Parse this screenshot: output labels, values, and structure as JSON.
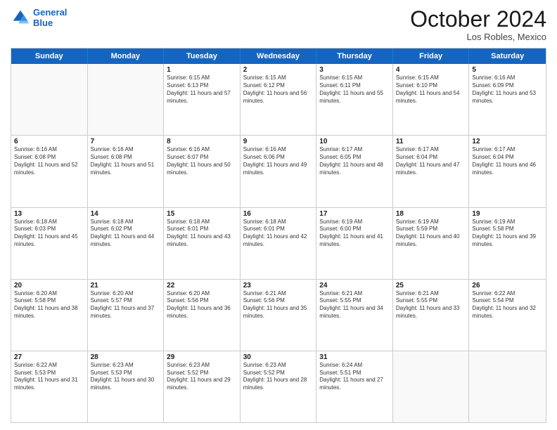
{
  "header": {
    "logo_line1": "General",
    "logo_line2": "Blue",
    "month": "October 2024",
    "location": "Los Robles, Mexico"
  },
  "days_of_week": [
    "Sunday",
    "Monday",
    "Tuesday",
    "Wednesday",
    "Thursday",
    "Friday",
    "Saturday"
  ],
  "weeks": [
    [
      {
        "day": "",
        "sunrise": "",
        "sunset": "",
        "daylight": ""
      },
      {
        "day": "",
        "sunrise": "",
        "sunset": "",
        "daylight": ""
      },
      {
        "day": "1",
        "sunrise": "Sunrise: 6:15 AM",
        "sunset": "Sunset: 6:13 PM",
        "daylight": "Daylight: 11 hours and 57 minutes."
      },
      {
        "day": "2",
        "sunrise": "Sunrise: 6:15 AM",
        "sunset": "Sunset: 6:12 PM",
        "daylight": "Daylight: 11 hours and 56 minutes."
      },
      {
        "day": "3",
        "sunrise": "Sunrise: 6:15 AM",
        "sunset": "Sunset: 6:11 PM",
        "daylight": "Daylight: 11 hours and 55 minutes."
      },
      {
        "day": "4",
        "sunrise": "Sunrise: 6:15 AM",
        "sunset": "Sunset: 6:10 PM",
        "daylight": "Daylight: 11 hours and 54 minutes."
      },
      {
        "day": "5",
        "sunrise": "Sunrise: 6:16 AM",
        "sunset": "Sunset: 6:09 PM",
        "daylight": "Daylight: 11 hours and 53 minutes."
      }
    ],
    [
      {
        "day": "6",
        "sunrise": "Sunrise: 6:16 AM",
        "sunset": "Sunset: 6:08 PM",
        "daylight": "Daylight: 11 hours and 52 minutes."
      },
      {
        "day": "7",
        "sunrise": "Sunrise: 6:16 AM",
        "sunset": "Sunset: 6:08 PM",
        "daylight": "Daylight: 11 hours and 51 minutes."
      },
      {
        "day": "8",
        "sunrise": "Sunrise: 6:16 AM",
        "sunset": "Sunset: 6:07 PM",
        "daylight": "Daylight: 11 hours and 50 minutes."
      },
      {
        "day": "9",
        "sunrise": "Sunrise: 6:16 AM",
        "sunset": "Sunset: 6:06 PM",
        "daylight": "Daylight: 11 hours and 49 minutes."
      },
      {
        "day": "10",
        "sunrise": "Sunrise: 6:17 AM",
        "sunset": "Sunset: 6:05 PM",
        "daylight": "Daylight: 11 hours and 48 minutes."
      },
      {
        "day": "11",
        "sunrise": "Sunrise: 6:17 AM",
        "sunset": "Sunset: 6:04 PM",
        "daylight": "Daylight: 11 hours and 47 minutes."
      },
      {
        "day": "12",
        "sunrise": "Sunrise: 6:17 AM",
        "sunset": "Sunset: 6:04 PM",
        "daylight": "Daylight: 11 hours and 46 minutes."
      }
    ],
    [
      {
        "day": "13",
        "sunrise": "Sunrise: 6:18 AM",
        "sunset": "Sunset: 6:03 PM",
        "daylight": "Daylight: 11 hours and 45 minutes."
      },
      {
        "day": "14",
        "sunrise": "Sunrise: 6:18 AM",
        "sunset": "Sunset: 6:02 PM",
        "daylight": "Daylight: 11 hours and 44 minutes."
      },
      {
        "day": "15",
        "sunrise": "Sunrise: 6:18 AM",
        "sunset": "Sunset: 6:01 PM",
        "daylight": "Daylight: 11 hours and 43 minutes."
      },
      {
        "day": "16",
        "sunrise": "Sunrise: 6:18 AM",
        "sunset": "Sunset: 6:01 PM",
        "daylight": "Daylight: 11 hours and 42 minutes."
      },
      {
        "day": "17",
        "sunrise": "Sunrise: 6:19 AM",
        "sunset": "Sunset: 6:00 PM",
        "daylight": "Daylight: 11 hours and 41 minutes."
      },
      {
        "day": "18",
        "sunrise": "Sunrise: 6:19 AM",
        "sunset": "Sunset: 5:59 PM",
        "daylight": "Daylight: 11 hours and 40 minutes."
      },
      {
        "day": "19",
        "sunrise": "Sunrise: 6:19 AM",
        "sunset": "Sunset: 5:58 PM",
        "daylight": "Daylight: 11 hours and 39 minutes."
      }
    ],
    [
      {
        "day": "20",
        "sunrise": "Sunrise: 6:20 AM",
        "sunset": "Sunset: 5:58 PM",
        "daylight": "Daylight: 11 hours and 38 minutes."
      },
      {
        "day": "21",
        "sunrise": "Sunrise: 6:20 AM",
        "sunset": "Sunset: 5:57 PM",
        "daylight": "Daylight: 11 hours and 37 minutes."
      },
      {
        "day": "22",
        "sunrise": "Sunrise: 6:20 AM",
        "sunset": "Sunset: 5:56 PM",
        "daylight": "Daylight: 11 hours and 36 minutes."
      },
      {
        "day": "23",
        "sunrise": "Sunrise: 6:21 AM",
        "sunset": "Sunset: 5:56 PM",
        "daylight": "Daylight: 11 hours and 35 minutes."
      },
      {
        "day": "24",
        "sunrise": "Sunrise: 6:21 AM",
        "sunset": "Sunset: 5:55 PM",
        "daylight": "Daylight: 11 hours and 34 minutes."
      },
      {
        "day": "25",
        "sunrise": "Sunrise: 6:21 AM",
        "sunset": "Sunset: 5:55 PM",
        "daylight": "Daylight: 11 hours and 33 minutes."
      },
      {
        "day": "26",
        "sunrise": "Sunrise: 6:22 AM",
        "sunset": "Sunset: 5:54 PM",
        "daylight": "Daylight: 11 hours and 32 minutes."
      }
    ],
    [
      {
        "day": "27",
        "sunrise": "Sunrise: 6:22 AM",
        "sunset": "Sunset: 5:53 PM",
        "daylight": "Daylight: 11 hours and 31 minutes."
      },
      {
        "day": "28",
        "sunrise": "Sunrise: 6:23 AM",
        "sunset": "Sunset: 5:53 PM",
        "daylight": "Daylight: 11 hours and 30 minutes."
      },
      {
        "day": "29",
        "sunrise": "Sunrise: 6:23 AM",
        "sunset": "Sunset: 5:52 PM",
        "daylight": "Daylight: 11 hours and 29 minutes."
      },
      {
        "day": "30",
        "sunrise": "Sunrise: 6:23 AM",
        "sunset": "Sunset: 5:52 PM",
        "daylight": "Daylight: 11 hours and 28 minutes."
      },
      {
        "day": "31",
        "sunrise": "Sunrise: 6:24 AM",
        "sunset": "Sunset: 5:51 PM",
        "daylight": "Daylight: 11 hours and 27 minutes."
      },
      {
        "day": "",
        "sunrise": "",
        "sunset": "",
        "daylight": ""
      },
      {
        "day": "",
        "sunrise": "",
        "sunset": "",
        "daylight": ""
      }
    ]
  ]
}
